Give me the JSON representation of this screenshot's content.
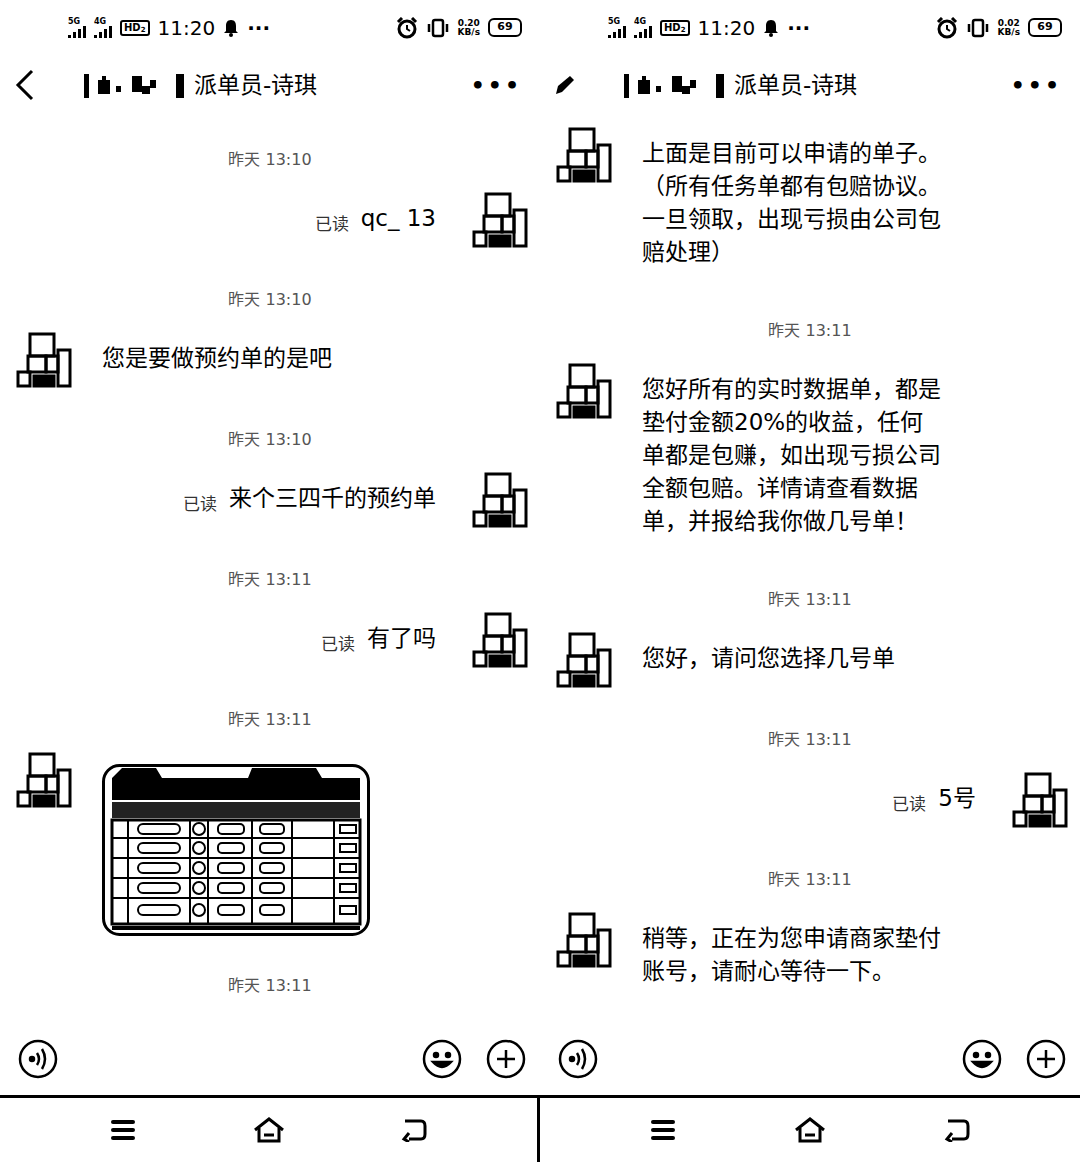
{
  "panels": [
    {
      "status_bar": {
        "net1": "5G",
        "net2": "4G",
        "hd": "HD",
        "hd_sub": "2",
        "time": "11:20",
        "more": "···",
        "speed": "0.20",
        "speed_unit": "KB/s",
        "battery": "69"
      },
      "header": {
        "leading": "back",
        "title": "派单员-诗琪",
        "menu": "•••"
      },
      "messages": [
        {
          "kind": "time",
          "text": "昨天 13:10"
        },
        {
          "kind": "text",
          "side": "out",
          "text": "qc_ 13",
          "read": "已读"
        },
        {
          "kind": "time",
          "text": "昨天 13:10"
        },
        {
          "kind": "text",
          "side": "in",
          "text": "您是要做预约单的是吧"
        },
        {
          "kind": "time",
          "text": "昨天 13:10"
        },
        {
          "kind": "text",
          "side": "out",
          "text": "来个三四千的预约单",
          "read": "已读"
        },
        {
          "kind": "time",
          "text": "昨天 13:11"
        },
        {
          "kind": "text",
          "side": "out",
          "text": "有了吗",
          "read": "已读"
        },
        {
          "kind": "time",
          "text": "昨天 13:11"
        },
        {
          "kind": "image",
          "side": "in"
        },
        {
          "kind": "time",
          "text": "昨天 13:11"
        }
      ]
    },
    {
      "status_bar": {
        "net1": "5G",
        "net2": "4G",
        "hd": "HD",
        "hd_sub": "2",
        "time": "11:20",
        "more": "···",
        "speed": "0.02",
        "speed_unit": "KB/s",
        "battery": "69"
      },
      "header": {
        "leading": "edit",
        "title": "派单员-诗琪",
        "menu": "•••"
      },
      "messages": [
        {
          "kind": "text",
          "side": "in",
          "text": "上面是目前可以申请的单子。（所有任务单都有包赔协议。一旦领取，出现亏损由公司包赔处理）"
        },
        {
          "kind": "time",
          "text": "昨天 13:11"
        },
        {
          "kind": "text",
          "side": "in",
          "text": "您好所有的实时数据单，都是垫付金额20%的收益，任何单都是包赚，如出现亏损公司全额包赔。详情请查看数据单，并报给我你做几号单！"
        },
        {
          "kind": "time",
          "text": "昨天 13:11"
        },
        {
          "kind": "text",
          "side": "in",
          "text": "您好，请问您选择几号单"
        },
        {
          "kind": "time",
          "text": "昨天 13:11"
        },
        {
          "kind": "text",
          "side": "out",
          "text": "5号",
          "read": "已读"
        },
        {
          "kind": "time",
          "text": "昨天 13:11"
        },
        {
          "kind": "text",
          "side": "in",
          "text": "稍等，正在为您申请商家垫付账号，请耐心等待一下。"
        }
      ]
    }
  ]
}
